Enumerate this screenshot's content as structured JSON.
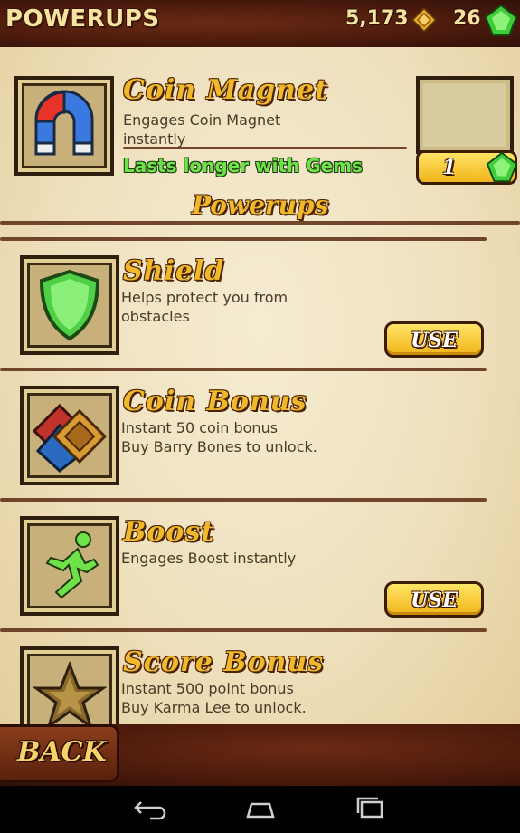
{
  "header": {
    "title": "POWERUPS",
    "coins": "5,173",
    "gems": "26"
  },
  "featured": {
    "name": "Coin Magnet",
    "description": "Engages Coin Magnet\ninstantly",
    "note": "Lasts longer with Gems",
    "buy_count": "1",
    "icon": "magnet-icon"
  },
  "section_title": "Powerups",
  "items": [
    {
      "name": "Shield",
      "description": "Helps protect you from\nobstacles",
      "action": "USE",
      "icon": "shield-icon"
    },
    {
      "name": "Coin Bonus",
      "description": "Instant 50 coin bonus\nBuy Barry Bones to unlock.",
      "icon": "coin-bonus-icon"
    },
    {
      "name": "Boost",
      "description": "Engages Boost instantly",
      "action": "USE",
      "icon": "runner-icon"
    },
    {
      "name": "Score Bonus",
      "description": "Instant 500 point bonus\nBuy Karma Lee to unlock.",
      "icon": "star-icon"
    }
  ],
  "back_label": "BACK",
  "colors": {
    "accent": "#f0b82a",
    "note_green": "#6fe24a",
    "leather": "#4a1a0c"
  }
}
